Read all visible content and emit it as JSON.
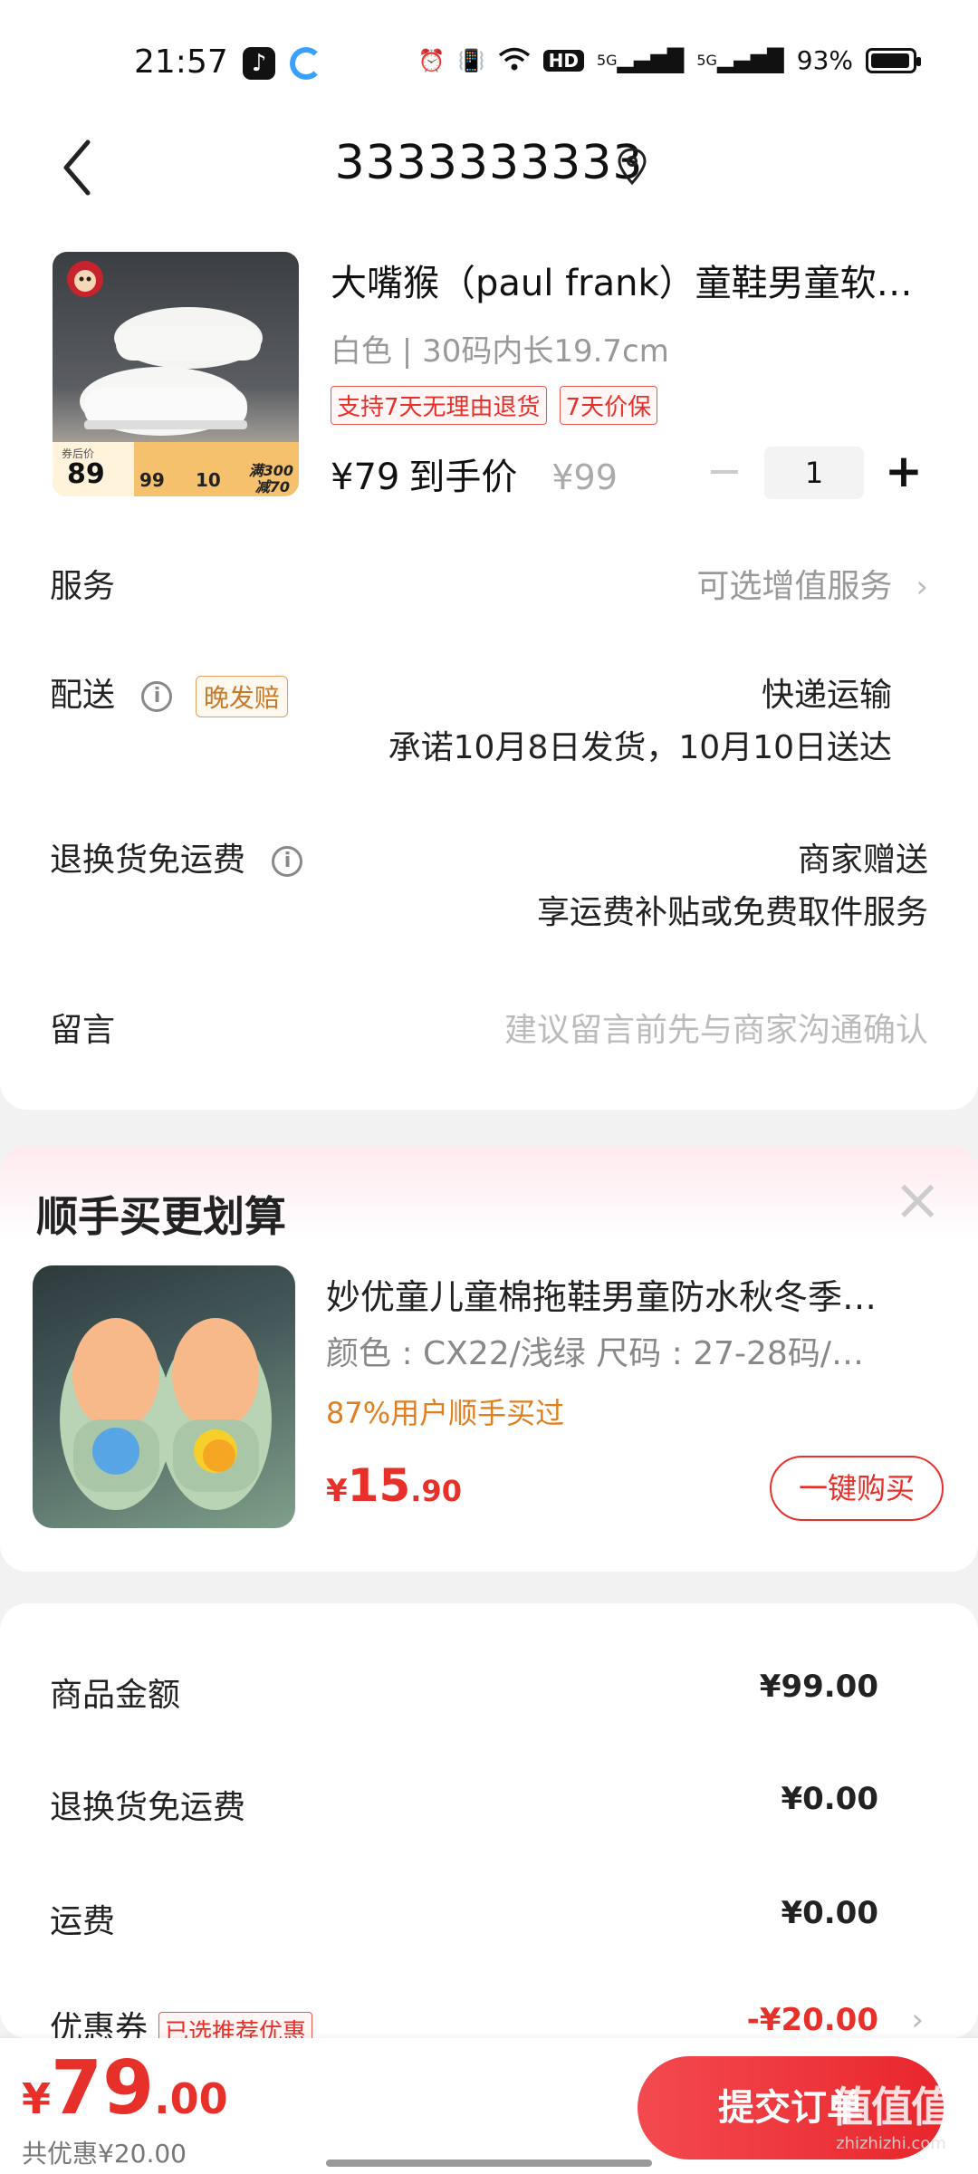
{
  "status_bar": {
    "time": "21:57",
    "battery_text": "93%",
    "hd_label": "HD",
    "signal1": "5G",
    "signal2": "5G"
  },
  "header": {
    "title": "3333333333"
  },
  "product": {
    "name": "大嘴猴（paul frank）童鞋男童软…",
    "spec": "白色 | 30码内长19.7cm",
    "tags": [
      "支持7天无理由退货",
      "7天价保"
    ],
    "price": "¥79",
    "price_label": "到手价",
    "original_price": "¥99",
    "quantity": "1",
    "image_badge": {
      "price_label": "券后价",
      "price": "89",
      "promo_top": "满300",
      "promo_bottom": "减70",
      "mid_a": "99",
      "mid_b": "10"
    }
  },
  "rows": {
    "service_label": "服务",
    "service_value": "可选增值服务",
    "delivery_label": "配送",
    "delivery_badge": "晚发赔",
    "delivery_value": "快递运输",
    "delivery_promise": "承诺10月8日发货，10月10日送达",
    "return_label": "退换货免运费",
    "return_value": "商家赠送",
    "return_desc": "享运费补贴或免费取件服务",
    "note_label": "留言",
    "note_placeholder": "建议留言前先与商家沟通确认"
  },
  "upsell": {
    "title": "顺手买更划算",
    "name": "妙优童儿童棉拖鞋男童防水秋冬季…",
    "spec": "颜色 : CX22/浅绿   尺码 : 27-28码/…",
    "bought": "87%用户顺手买过",
    "price_cur": "¥",
    "price_int": "15",
    "price_dec": ".90",
    "buy_label": "一键购买"
  },
  "summary": {
    "goods_label": "商品金额",
    "goods_amount": "¥99.00",
    "return_fee_label": "退换货免运费",
    "return_fee_amount": "¥0.00",
    "shipping_label": "运费",
    "shipping_amount": "¥0.00",
    "coupon_label": "优惠券",
    "coupon_tag": "已选推荐优惠",
    "coupon_amount": "-¥20.00"
  },
  "bottom": {
    "total_cur": "¥",
    "total_int": "79",
    "total_dec": ".00",
    "saved": "共优惠¥20.00",
    "submit_label": "提交订单",
    "watermark": "值值值",
    "watermark_url": "zhizhizhi.com"
  },
  "colors": {
    "accent": "#e8302a",
    "orange": "#e17e1e"
  }
}
